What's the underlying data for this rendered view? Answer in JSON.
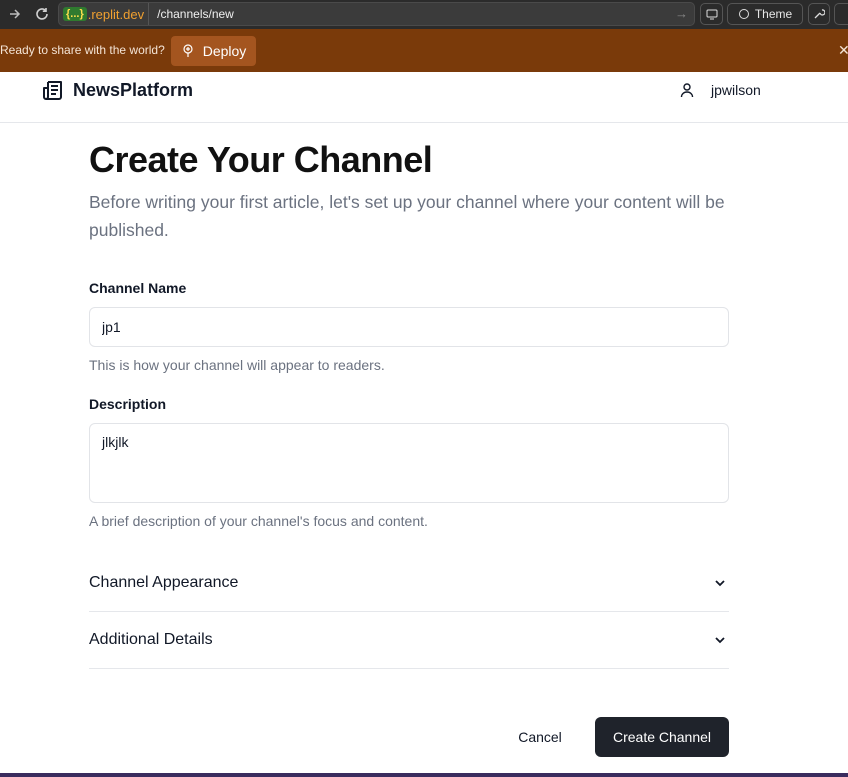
{
  "browser": {
    "url_badge": "{...}",
    "url_host": ".replit.dev",
    "url_path": "/channels/new",
    "theme_label": "Theme"
  },
  "banner": {
    "text": "Ready to share with the world?",
    "deploy_label": "Deploy"
  },
  "header": {
    "brand": "NewsPlatform",
    "username": "jpwilson"
  },
  "page": {
    "title": "Create Your Channel",
    "subtitle": "Before writing your first article, let's set up your channel where your content will be published."
  },
  "form": {
    "name_label": "Channel Name",
    "name_value": "jp1",
    "name_help": "This is how your channel will appear to readers.",
    "description_label": "Description",
    "description_value": "jlkjlk",
    "description_help": "A brief description of your channel's focus and content.",
    "sections": [
      {
        "label": "Channel Appearance",
        "icon": "chevron-down-icon"
      },
      {
        "label": "Additional Details",
        "icon": "chevron-down-icon"
      }
    ],
    "cancel_label": "Cancel",
    "submit_label": "Create Channel"
  },
  "colors": {
    "banner_bg": "#7a3a0a",
    "primary_button": "#1f232b"
  }
}
